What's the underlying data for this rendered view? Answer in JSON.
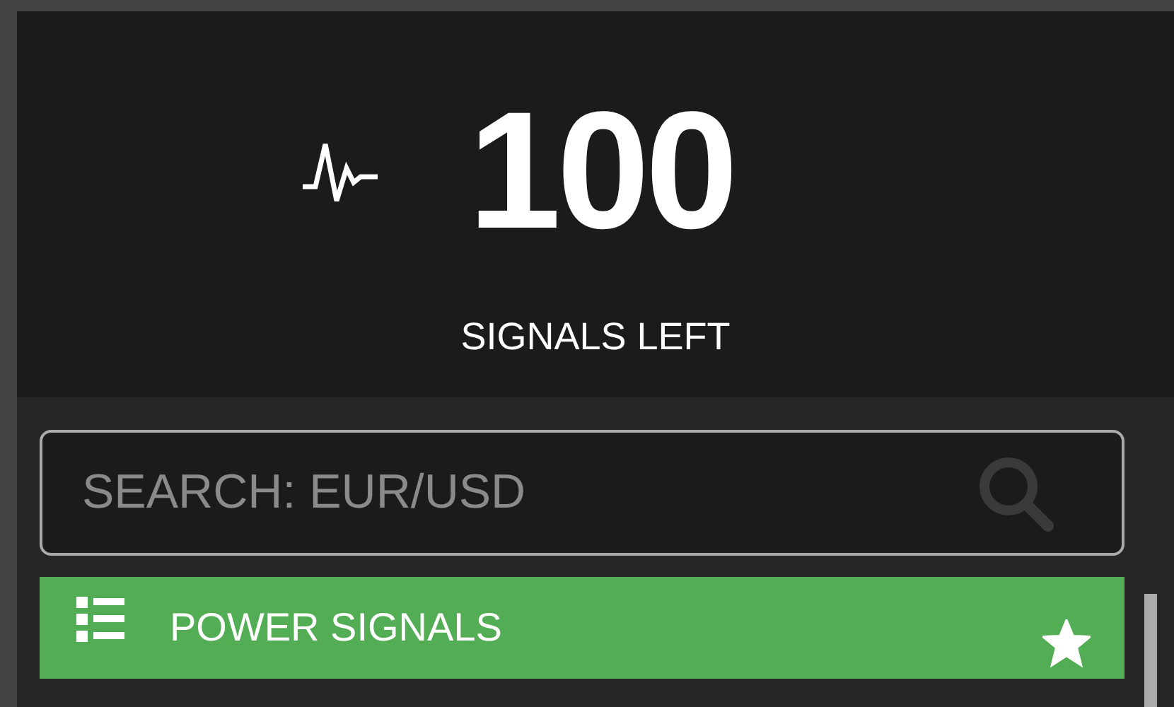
{
  "counter": {
    "value": "100",
    "label": "SIGNALS LEFT"
  },
  "search": {
    "placeholder": "SEARCH: EUR/USD"
  },
  "menu": [
    {
      "label": "POWER SIGNALS",
      "selected": true,
      "starred": true
    }
  ]
}
